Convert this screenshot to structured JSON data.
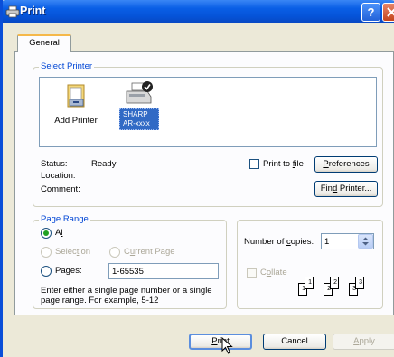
{
  "window": {
    "title": "Print",
    "help_glyph": "?"
  },
  "tabs": [
    {
      "label": "General",
      "active": true
    }
  ],
  "select_printer": {
    "legend": "Select Printer",
    "printers": [
      {
        "label": "Add Printer",
        "icon": "add-printer-icon",
        "selected": false
      },
      {
        "label_line1": "SHARP",
        "label_line2": "AR-xxxx",
        "icon": "printer-icon",
        "selected": true
      }
    ],
    "status_label": "Status:",
    "status_value": "Ready",
    "location_label": "Location:",
    "location_value": "",
    "comment_label": "Comment:",
    "comment_value": "",
    "print_to_file": {
      "pre": "Print to ",
      "accel": "f",
      "post": "ile",
      "checked": false
    },
    "preferences": {
      "accel": "P",
      "post": "references"
    },
    "find_printer": {
      "pre": "Fin",
      "accel": "d",
      "post": " Printer..."
    }
  },
  "page_range": {
    "legend": "Page Range",
    "all": {
      "accel": "l",
      "pre": "A",
      "post": "",
      "checked": true
    },
    "selection": {
      "pre": "Selec",
      "accel": "t",
      "post": "ion",
      "enabled": false
    },
    "current_page": {
      "pre": "C",
      "accel": "u",
      "post": "rrent Page",
      "enabled": false
    },
    "pages": {
      "pre": "Pa",
      "accel": "g",
      "post": "es:",
      "value": "1-65535"
    },
    "hint": "Enter either a single page number or a single page range.  For example, 5-12"
  },
  "copies": {
    "label_pre": "Number of ",
    "label_accel": "c",
    "label_post": "opies:",
    "value": "1",
    "collate": {
      "pre": "C",
      "accel": "o",
      "post": "llate",
      "checked": false,
      "enabled": false
    },
    "collate_pages": [
      "1",
      "1",
      "2",
      "2",
      "3",
      "3"
    ]
  },
  "buttons": {
    "print": {
      "accel": "P",
      "post": "rint"
    },
    "cancel": "Cancel",
    "apply": {
      "accel": "A",
      "post": "pply"
    }
  },
  "colors": {
    "title_bar": "#0553d8",
    "dialog_bg": "#ece9d8",
    "group_legend": "#0046d5",
    "selection": "#316ac5",
    "radio_dot": "#21a121"
  }
}
